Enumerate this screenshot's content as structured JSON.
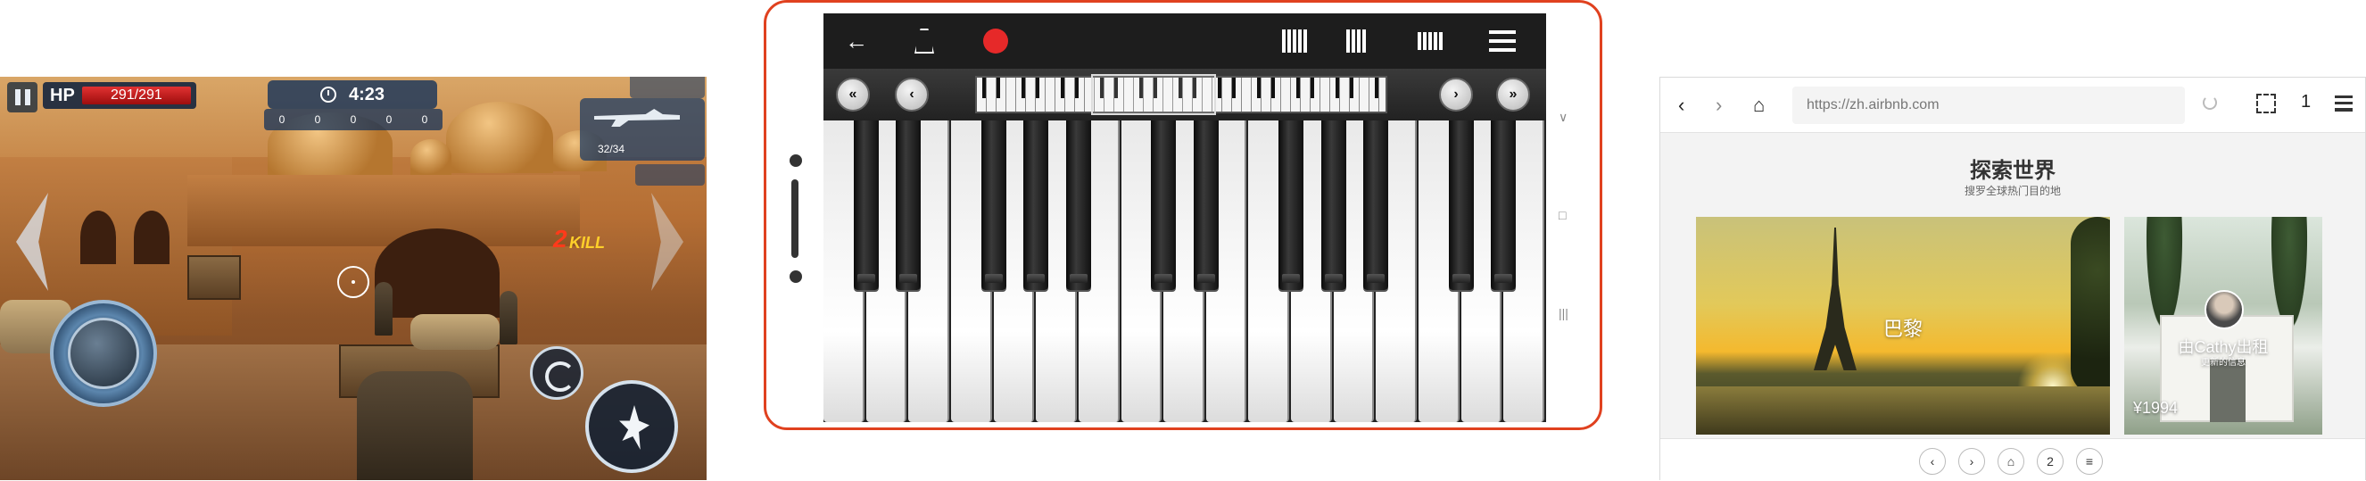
{
  "game": {
    "hp_label": "HP",
    "hp_value": "291/291",
    "timer": "4:23",
    "stats": [
      "0",
      "0",
      "0",
      "0",
      "0"
    ],
    "ammo": "32/34",
    "kill_count": "2",
    "kill_text": "KILL",
    "icons": {
      "pause": "pause-icon",
      "clock": "clock-icon",
      "weapon": "rifle-icon",
      "reload": "reload-icon",
      "fire": "fire-icon",
      "joystick": "joystick-icon"
    }
  },
  "piano": {
    "toolbar": {
      "back": "←",
      "icons": [
        "back-arrow-icon",
        "metronome-icon",
        "record-icon",
        "piano-keys-icon",
        "dual-keys-icon",
        "stage-icon",
        "menu-icon"
      ]
    },
    "nav": {
      "ffl": "«",
      "fl": "‹",
      "fr": "›",
      "ffr": "»"
    },
    "phone_nav": [
      "∨",
      "□",
      "|||"
    ],
    "colors": {
      "record": "#e62929",
      "frame": "#e0411f"
    }
  },
  "browser": {
    "back": "‹",
    "forward": "›",
    "home": "⌂",
    "url": "https://zh.airbnb.com",
    "tab_count": "1",
    "title": "探索世界",
    "subtitle": "搜罗全球热门目的地",
    "cards": [
      {
        "label": "巴黎"
      },
      {
        "host": "由Cathy出租",
        "host_sub": "更新的信息",
        "price": "¥1994"
      }
    ],
    "bottom": {
      "prev": "‹",
      "next": "›",
      "home": "⌂",
      "tabs": "2",
      "menu": "≡"
    }
  }
}
